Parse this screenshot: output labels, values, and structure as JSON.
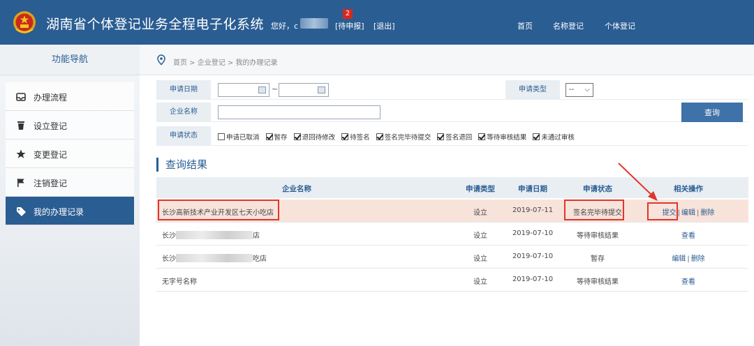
{
  "header": {
    "title": "湖南省个体登记业务全程电子化系统",
    "greeting": "您好，c",
    "pending_count": "2",
    "pending_label": "[待申报]",
    "logout_label": "[退出]",
    "nav": [
      "首页",
      "名称登记",
      "个体登记"
    ]
  },
  "sidebar": {
    "title": "功能导航",
    "items": [
      {
        "label": "办理流程",
        "icon": "inbox-icon"
      },
      {
        "label": "设立登记",
        "icon": "trash-icon"
      },
      {
        "label": "变更登记",
        "icon": "star-icon"
      },
      {
        "label": "注销登记",
        "icon": "flag-icon"
      },
      {
        "label": "我的办理记录",
        "icon": "tag-icon",
        "active": true
      }
    ]
  },
  "breadcrumb": "首页 > 企业登记 > 我的办理记录",
  "form": {
    "date_label": "申请日期",
    "date_sep": "~",
    "type_label": "申请类型",
    "type_value": "--",
    "name_label": "企业名称",
    "name_value": "",
    "status_label": "申请状态",
    "query_button": "查询",
    "statuses": [
      {
        "label": "申请已取消",
        "checked": false
      },
      {
        "label": "暂存",
        "checked": true
      },
      {
        "label": "退回待修改",
        "checked": true
      },
      {
        "label": "待签名",
        "checked": true
      },
      {
        "label": "签名完毕待提交",
        "checked": true
      },
      {
        "label": "签名退回",
        "checked": true
      },
      {
        "label": "等待审核结果",
        "checked": true
      },
      {
        "label": "未通过审核",
        "checked": true
      }
    ]
  },
  "results": {
    "title": "查询结果",
    "columns": [
      "企业名称",
      "申请类型",
      "申请日期",
      "申请状态",
      "相关操作"
    ],
    "rows": [
      {
        "name": "长沙高新技术产业开发区七天小吃店",
        "type": "设立",
        "date": "2019-07-11",
        "status": "签名完毕待提交",
        "ops": [
          "提交",
          "编辑",
          "删除"
        ]
      },
      {
        "name_prefix": "长沙",
        "name_suffix": "店",
        "type": "设立",
        "date": "2019-07-10",
        "status": "等待审核结果",
        "ops": [
          "查看"
        ]
      },
      {
        "name_prefix": "长沙",
        "name_suffix": "吃店",
        "type": "设立",
        "date": "2019-07-10",
        "status": "暂存",
        "ops": [
          "编辑",
          "删除"
        ]
      },
      {
        "name": "无字号名称",
        "type": "设立",
        "date": "2019-07-10",
        "status": "等待审核结果",
        "ops": [
          "查看"
        ]
      }
    ]
  },
  "colors": {
    "brand": "#2a5d92",
    "highlight_row": "#f8e3db",
    "annotation_red": "#e0352b",
    "badge": "#d7281e"
  }
}
